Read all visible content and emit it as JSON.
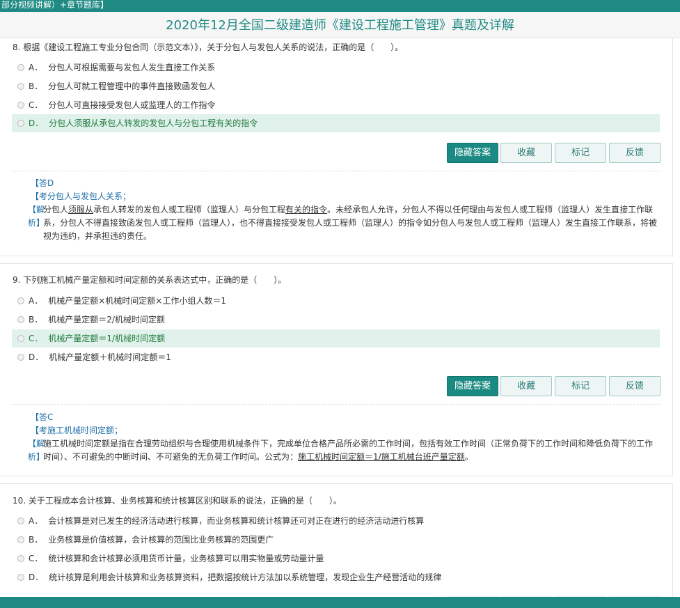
{
  "topbar": {
    "text": "部分视频讲解）+章节题库】"
  },
  "page_title": "2020年12月全国二级建造师《建设工程施工管理》真题及详解",
  "buttons": {
    "hide": "隐藏答案",
    "collect": "收藏",
    "mark": "标记",
    "feedback": "反馈"
  },
  "questions": [
    {
      "stem": "8. 根据《建设工程施工专业分包合同（示范文本）》，关于分包人与发包人关系的说法，正确的是（　　）。",
      "options": [
        {
          "letter": "A．",
          "text": "分包人可根据需要与发包人发生直接工作关系"
        },
        {
          "letter": "B．",
          "text": "分包人可就工程管理中的事件直接致函发包人"
        },
        {
          "letter": "C．",
          "text": "分包人可直接接受发包人或监理人的工作指令"
        },
        {
          "letter": "D．",
          "text": "分包人须服从承包人转发的发包人与分包工程有关的指令"
        }
      ],
      "answer": "【答D",
      "point": "【考分包人与发包人关系；",
      "explain_label_1": "【解",
      "explain_label_2": "析】",
      "explain_pre": "分包人",
      "explain_u1": "须服从",
      "explain_mid": "承包人转发的发包人或工程师（监理人）与分包工程",
      "explain_u2": "有关的指令",
      "explain_post": "。未经承包人允许，分包人不得以任何理由与发包人或工程师（监理人）发生直接工作联系，分包人不得直接致函发包人或工程师（监理人），也不得直接接受发包人或工程师（监理人）的指令如分包人与发包人或工程师（监理人）发生直接工作联系，将被视为违约，并承担违约责任。"
    },
    {
      "stem": "9. 下列施工机械产量定额和时间定额的关系表达式中，正确的是（　　）。",
      "options": [
        {
          "letter": "A．",
          "text": "机械产量定额×机械时间定额×工作小组人数＝1"
        },
        {
          "letter": "B．",
          "text": "机械产量定额＝2/机械时间定额"
        },
        {
          "letter": "C．",
          "text": "机械产量定额＝1/机械时间定额"
        },
        {
          "letter": "D．",
          "text": "机械产量定额＋机械时间定额＝1"
        }
      ],
      "answer": "【答C",
      "point": "【考施工机械时间定额；",
      "explain_label_1": "【解",
      "explain_label_2": "析】",
      "explain_pre": "施工机械时间定额是指在合理劳动组织与合理使用机械条件下，完成单位合格产品所必需的工作时间，包括有效工作时间（正常负荷下的工作时间和降低负荷下的工作时间）、不可避免的中断时间、不可避免的无负荷工作时间。公式为：",
      "explain_u1": "施工机械时间定额＝1/施工机械台班产量定额",
      "explain_post": "。"
    },
    {
      "stem": "10. 关于工程成本会计核算、业务核算和统计核算区别和联系的说法，正确的是（　　）。",
      "options": [
        {
          "letter": "A．",
          "text": "会计核算是对已发生的经济活动进行核算，而业务核算和统计核算还可对正在进行的经济活动进行核算"
        },
        {
          "letter": "B．",
          "text": "业务核算是价值核算，会计核算的范围比业务核算的范围更广"
        },
        {
          "letter": "C．",
          "text": "统计核算和会计核算必须用货币计量，业务核算可以用实物量或劳动量计量"
        },
        {
          "letter": "D．",
          "text": "统计核算是利用会计核算和业务核算资料，把数据按统计方法加以系统管理，发现企业生产经营活动的规律"
        }
      ]
    }
  ],
  "colors": {
    "accent": "#1f8a84",
    "correct_bg": "#e1f1ec",
    "correct_text": "#1e7a3a",
    "label_blue": "#1f6fa8"
  }
}
